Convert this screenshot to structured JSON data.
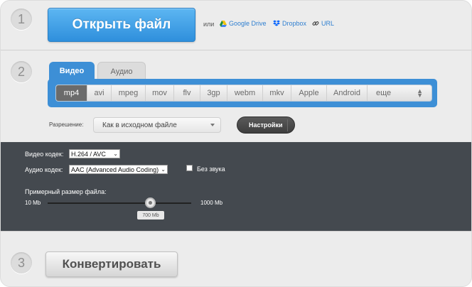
{
  "steps": {
    "one": "1",
    "two": "2",
    "three": "3"
  },
  "open": {
    "button_label": "Открыть файл",
    "or_text": "или",
    "sources": [
      {
        "label": "Google Drive",
        "icon": "google-drive-icon"
      },
      {
        "label": "Dropbox",
        "icon": "dropbox-icon"
      },
      {
        "label": "URL",
        "icon": "link-icon"
      }
    ]
  },
  "tabs": {
    "video": "Видео",
    "audio": "Аудио",
    "active": "Видео"
  },
  "formats": {
    "items": [
      "mp4",
      "avi",
      "mpeg",
      "mov",
      "flv",
      "3gp",
      "webm",
      "mkv",
      "Apple",
      "Android"
    ],
    "selected": "mp4",
    "more_label": "еще"
  },
  "resolution": {
    "label": "Разрешение:",
    "value": "Как в исходном файле"
  },
  "settings_button": "Настройки",
  "advanced": {
    "video_codec_label": "Видео кодек:",
    "video_codec_value": "H.264 / AVC",
    "audio_codec_label": "Аудио кодек:",
    "audio_codec_value": "AAC (Advanced Audio Coding)",
    "no_sound_label": "Без звука",
    "no_sound_checked": false,
    "size_label": "Примерный размер файла:",
    "size_min": "10 Mb",
    "size_max": "1000 Mb",
    "size_value": "700 Mb"
  },
  "convert_button": "Конвертировать",
  "colors": {
    "accent": "#3d8fd6",
    "open_button": "#2f8fdc",
    "dark_panel": "#44494f"
  }
}
